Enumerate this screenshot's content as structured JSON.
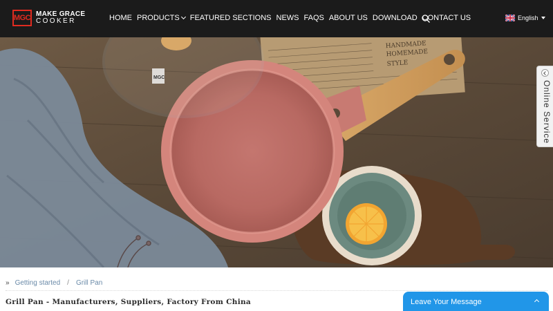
{
  "header": {
    "logo_mark": "MGC",
    "logo_line1": "MAKE GRACE",
    "logo_line2": "COOKER",
    "nav": [
      {
        "label": "HOME"
      },
      {
        "label": "PRODUCTS"
      },
      {
        "label": "FEATURED SECTIONS"
      },
      {
        "label": "NEWS"
      },
      {
        "label": "FAQS"
      },
      {
        "label": "ABOUT US"
      },
      {
        "label": "DOWNLOAD"
      },
      {
        "label": "CONTACT US"
      }
    ],
    "search_icon": "search-icon",
    "language": "English",
    "language_flag": "uk-flag-icon"
  },
  "hero": {
    "newspaper_line1": "HANDMADE",
    "newspaper_line2": "HOMEMADE",
    "newspaper_line3": "STYLE",
    "lid_logo": "MGC"
  },
  "side_tab": {
    "label": "Online Service"
  },
  "breadcrumb": {
    "items": [
      "Getting started",
      "Grill Pan"
    ]
  },
  "page": {
    "title": "Grill Pan - Manufacturers, Suppliers, Factory From China"
  },
  "chat": {
    "label": "Leave Your Message"
  },
  "colors": {
    "header_bg": "#1b1b1b",
    "accent": "#2196e8",
    "brand_red": "#e02b20"
  }
}
